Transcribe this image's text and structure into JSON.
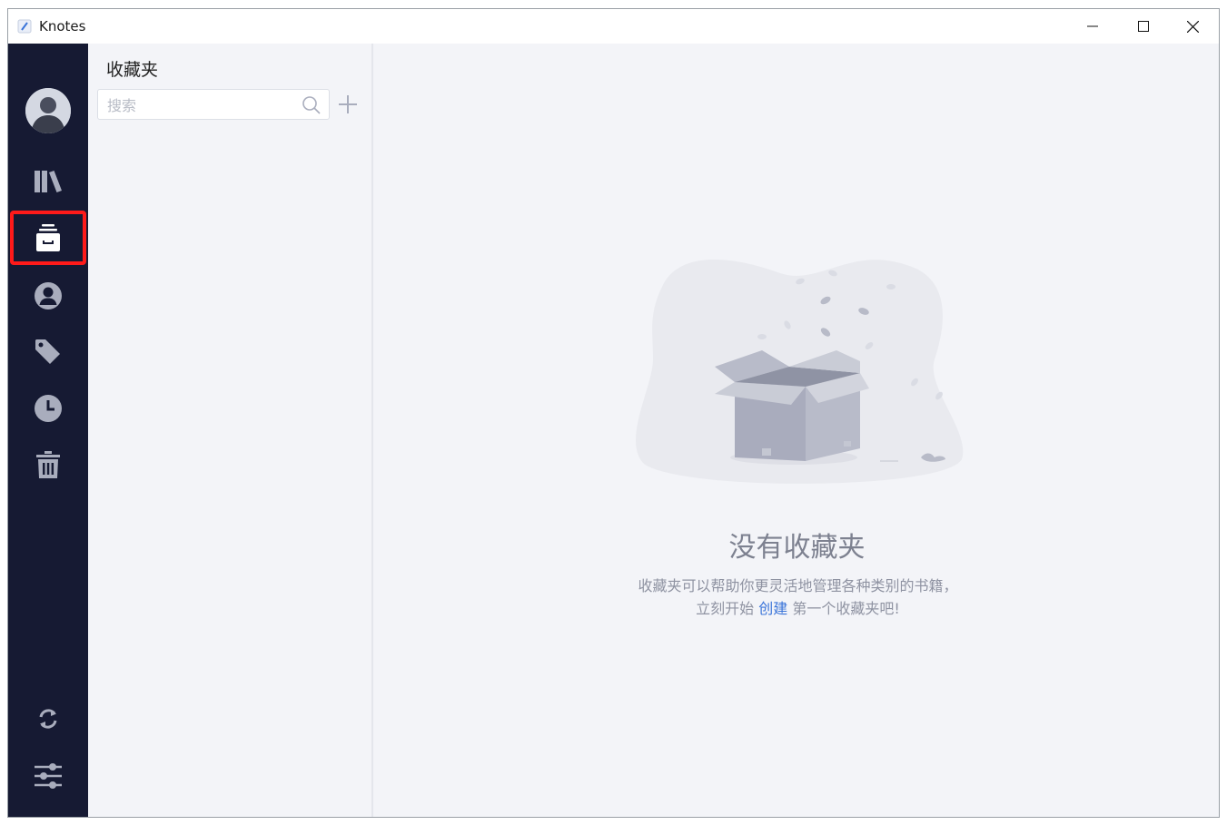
{
  "window": {
    "title": "Knotes"
  },
  "titlebar": {
    "minimize_icon": "minimize-icon",
    "maximize_icon": "maximize-icon",
    "close_icon": "close-icon"
  },
  "sidebar": {
    "items": [
      {
        "name": "library",
        "icon": "books-icon"
      },
      {
        "name": "favorites",
        "icon": "archive-box-icon",
        "selected": true
      },
      {
        "name": "authors",
        "icon": "person-circle-icon"
      },
      {
        "name": "tags",
        "icon": "tag-icon"
      },
      {
        "name": "recent",
        "icon": "clock-icon"
      },
      {
        "name": "trash",
        "icon": "trash-icon"
      }
    ],
    "bottom": [
      {
        "name": "sync",
        "icon": "sync-icon"
      },
      {
        "name": "settings",
        "icon": "sliders-icon"
      }
    ],
    "selected_outline_color": "#ff1a1a"
  },
  "list": {
    "title": "收藏夹",
    "search": {
      "placeholder": "搜索",
      "value": ""
    },
    "add_icon": "plus-icon"
  },
  "main": {
    "empty_title": "没有收藏夹",
    "empty_desc_before": "收藏夹可以帮助你更灵活地管理各种类别的书籍，立刻开始",
    "create_link": "创建",
    "empty_desc_after": "第一个收藏夹吧!",
    "illustration": "empty-box-illustration"
  },
  "colors": {
    "sidebar_bg": "#161a33",
    "pane_bg": "#f3f4f8",
    "link": "#3a74d9",
    "icon": "#a9adbd"
  }
}
